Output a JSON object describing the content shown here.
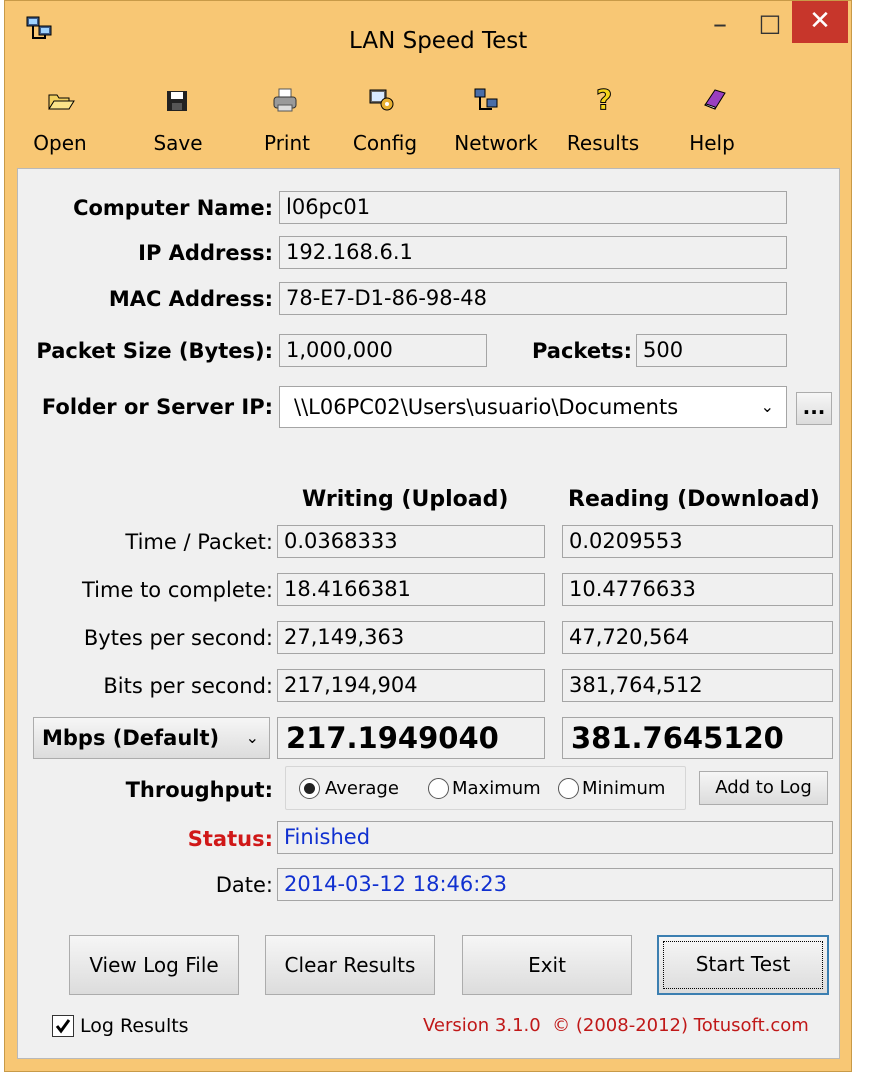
{
  "window": {
    "title": "LAN Speed Test",
    "minimize": "–",
    "maximize": "□",
    "close": "✕"
  },
  "toolbar": {
    "open": "Open",
    "save": "Save",
    "print": "Print",
    "config": "Config",
    "network": "Network",
    "results": "Results",
    "help": "Help"
  },
  "form": {
    "computer_name_label": "Computer Name:",
    "computer_name": "l06pc01",
    "ip_label": "IP Address:",
    "ip": "192.168.6.1",
    "mac_label": "MAC Address:",
    "mac": "78-E7-D1-86-98-48",
    "packet_size_label": "Packet Size (Bytes):",
    "packet_size": "1,000,000",
    "packets_label": "Packets:",
    "packets": "500",
    "folder_label": "Folder or Server IP:",
    "folder": "\\\\L06PC02\\Users\\usuario\\Documents",
    "browse": "..."
  },
  "results": {
    "writing_header": "Writing (Upload)",
    "reading_header": "Reading (Download)",
    "rows": [
      {
        "label": "Time / Packet:",
        "write": "0.0368333",
        "read": "0.0209553"
      },
      {
        "label": "Time to complete:",
        "write": "18.4166381",
        "read": "10.4776633"
      },
      {
        "label": "Bytes per second:",
        "write": "27,149,363",
        "read": "47,720,564"
      },
      {
        "label": "Bits per second:",
        "write": "217,194,904",
        "read": "381,764,512"
      }
    ],
    "unit_select": "Mbps (Default)",
    "write_big": "217.1949040",
    "read_big": "381.7645120"
  },
  "throughput": {
    "label": "Throughput:",
    "average": "Average",
    "maximum": "Maximum",
    "minimum": "Minimum",
    "selected": "Average",
    "add_to_log": "Add to Log"
  },
  "status": {
    "label": "Status:",
    "value": "Finished",
    "color": "#d01818",
    "value_color": "#1030d0"
  },
  "date": {
    "label": "Date:",
    "value": "2014-03-12 18:46:23"
  },
  "buttons": {
    "view_log": "View Log File",
    "clear": "Clear Results",
    "exit": "Exit",
    "start": "Start Test"
  },
  "footer": {
    "log_results": "Log Results",
    "version": "Version 3.1.0  © (2008-2012) Totusoft.com",
    "version_color": "#c01818"
  },
  "colors": {
    "frame": "#f8c774",
    "client": "#f0f0f0",
    "close": "#c7362b"
  }
}
